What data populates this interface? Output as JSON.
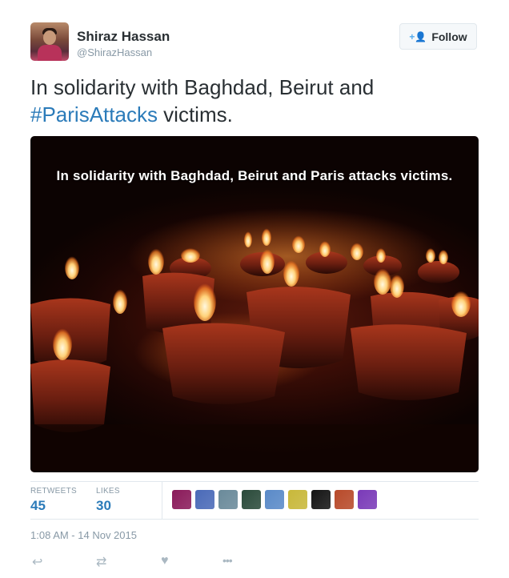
{
  "user": {
    "name": "Shiraz Hassan",
    "handle": "@ShirazHassan"
  },
  "follow_button": {
    "icon": "+👤",
    "label": "Follow"
  },
  "tweet": {
    "text_line1": "In solidarity with Baghdad, Beirut and",
    "hashtag": "#ParisAttacks",
    "text_tail": " victims."
  },
  "photo": {
    "caption": "In solidarity with Baghdad, Beirut and Paris attacks victims."
  },
  "stats": {
    "retweets_label": "RETWEETS",
    "retweets_value": "45",
    "likes_label": "LIKES",
    "likes_value": "30"
  },
  "likers": [
    {
      "name": "liker-avatar-1",
      "color": "#8a1a5a"
    },
    {
      "name": "liker-avatar-2",
      "color": "#4a6ab8"
    },
    {
      "name": "liker-avatar-3",
      "color": "#6a8a9a"
    },
    {
      "name": "liker-avatar-4",
      "color": "#2a4a3a"
    },
    {
      "name": "liker-avatar-5",
      "color": "#5a8ac8"
    },
    {
      "name": "liker-avatar-6",
      "color": "#c8b83a"
    },
    {
      "name": "liker-avatar-7",
      "color": "#141414"
    },
    {
      "name": "liker-avatar-8",
      "color": "#b84a2a"
    },
    {
      "name": "liker-avatar-9",
      "color": "#7a3ab8"
    }
  ],
  "timestamp": "1:08 AM - 14 Nov 2015",
  "actions": {
    "reply_icon": "↩",
    "retweet_icon": "⇄",
    "like_icon": "♥",
    "more_icon": "•••"
  }
}
